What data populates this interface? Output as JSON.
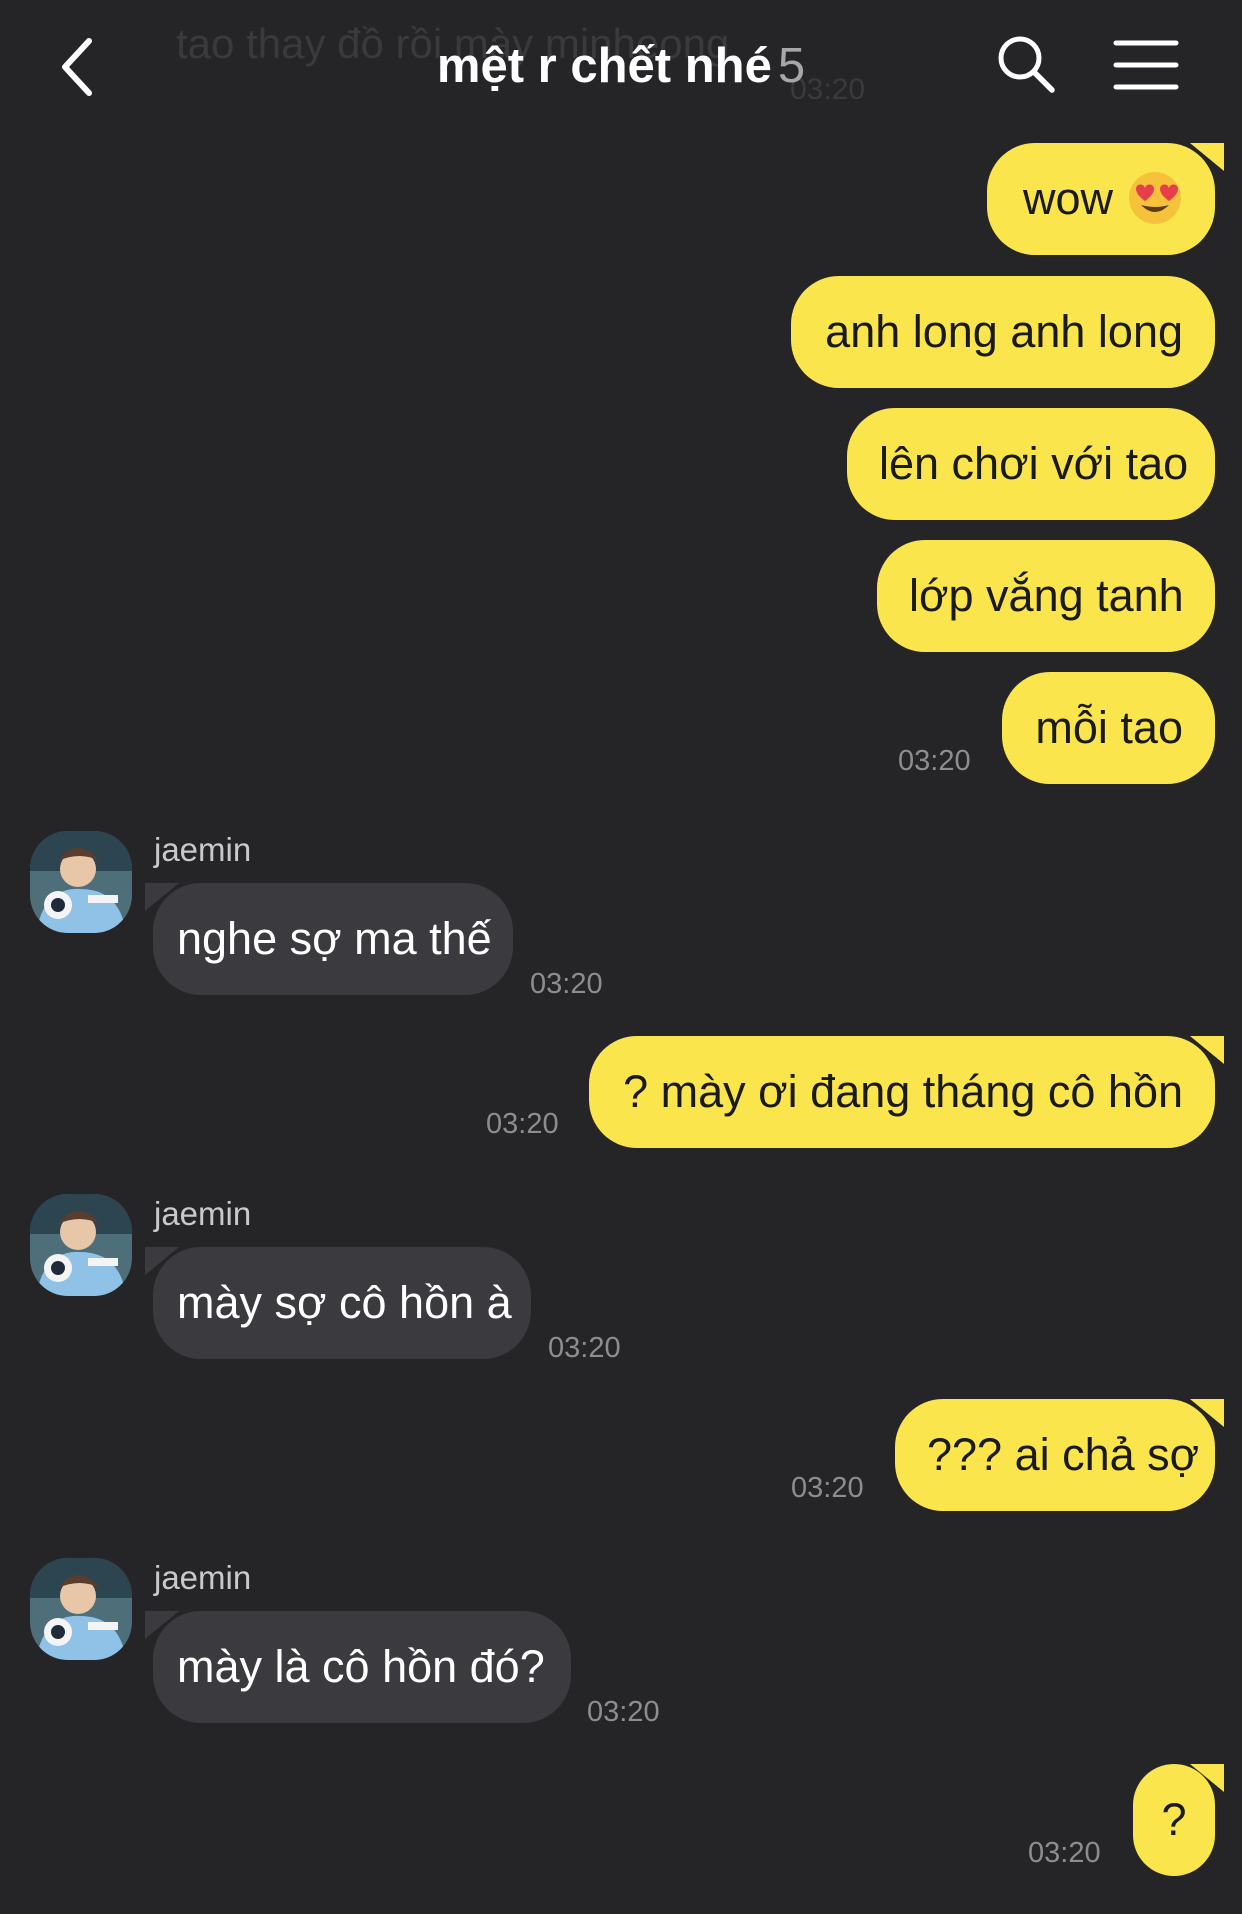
{
  "header": {
    "title": "mệt r chết nhé",
    "member_count": "5",
    "background_message": "tao thay đồ rồi mày minheong",
    "background_time": "03:20",
    "icons": {
      "back": "back-chevron-icon",
      "search": "search-icon",
      "menu": "menu-icon"
    }
  },
  "colors": {
    "background": "#252528",
    "outgoing_bubble": "#fae54d",
    "incoming_bubble": "#3b3b3f",
    "timestamp": "#8c8c91"
  },
  "messages": [
    {
      "direction": "outgoing",
      "text": "wow",
      "emoji": "heart-eyes-emoji"
    },
    {
      "direction": "outgoing",
      "text": "anh long anh long"
    },
    {
      "direction": "outgoing",
      "text": "lên chơi với tao"
    },
    {
      "direction": "outgoing",
      "text": "lớp vắng tanh"
    },
    {
      "direction": "outgoing",
      "text": "mỗi tao",
      "time": "03:20"
    },
    {
      "direction": "incoming",
      "sender": "jaemin",
      "text": "nghe sợ ma thế",
      "time": "03:20"
    },
    {
      "direction": "outgoing",
      "text": "? mày ơi đang tháng cô hồn",
      "time": "03:20"
    },
    {
      "direction": "incoming",
      "sender": "jaemin",
      "text": "mày sợ cô hồn à",
      "time": "03:20"
    },
    {
      "direction": "outgoing",
      "text": "??? ai chả sợ",
      "time": "03:20"
    },
    {
      "direction": "incoming",
      "sender": "jaemin",
      "text": "mày là cô hồn đó?",
      "time": "03:20"
    },
    {
      "direction": "outgoing",
      "text": "?",
      "time": "03:20"
    }
  ]
}
